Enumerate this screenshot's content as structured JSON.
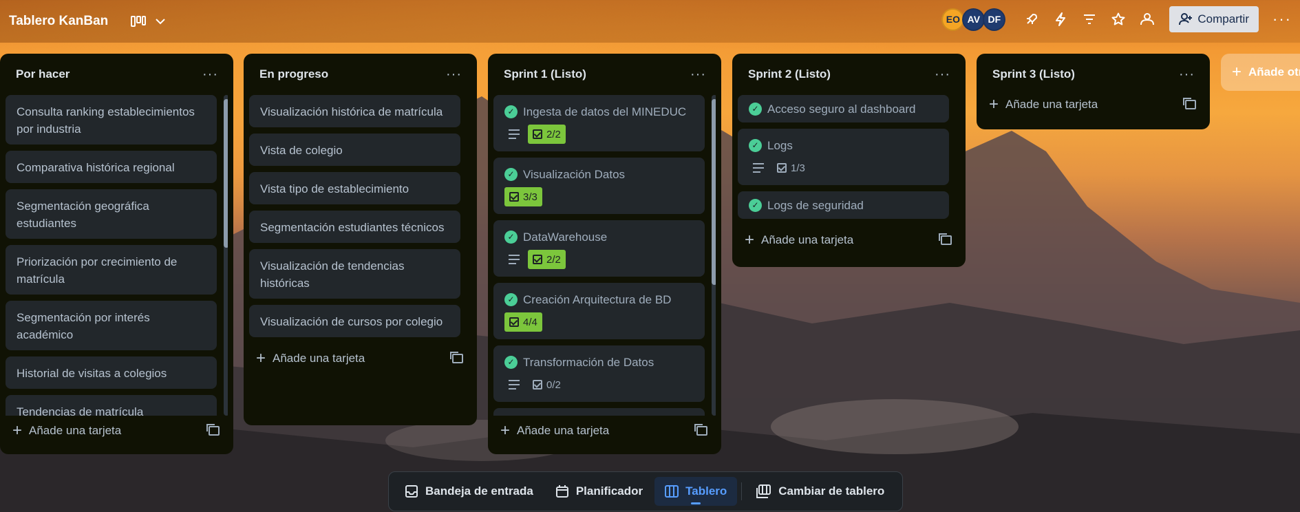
{
  "header": {
    "board_title": "Tablero KanBan",
    "avatars": [
      {
        "initials": "EO",
        "color": "#f5a524",
        "text_color": "#172b4d"
      },
      {
        "initials": "AV",
        "color": "#1f3b6f",
        "text_color": "#ffffff"
      },
      {
        "initials": "DF",
        "color": "#1f3b6f",
        "text_color": "#ffffff"
      }
    ],
    "share_label": "Compartir",
    "icons": [
      "board-view-icon",
      "chevron-down-icon",
      "power-ups-icon",
      "automation-icon",
      "filter-icon",
      "star-icon",
      "visibility-icon",
      "share-person-icon",
      "more-icon"
    ]
  },
  "lists": [
    {
      "title": "Por hacer",
      "add_label": "Añade una tarjeta",
      "cards": [
        {
          "title": "Consulta ranking establecimientos por industria"
        },
        {
          "title": "Comparativa histórica regional"
        },
        {
          "title": "Segmentación geográfica estudiantes"
        },
        {
          "title": "Priorización por crecimiento de matrícula"
        },
        {
          "title": "Segmentación por interés académico"
        },
        {
          "title": "Historial de visitas a colegios"
        },
        {
          "title": "Tendencias de matrícula"
        }
      ]
    },
    {
      "title": "En progreso",
      "add_label": "Añade una tarjeta",
      "cards": [
        {
          "title": "Visualización histórica de matrícula"
        },
        {
          "title": "Vista de colegio"
        },
        {
          "title": "Vista tipo de establecimiento"
        },
        {
          "title": "Segmentación estudiantes técnicos"
        },
        {
          "title": "Visualización de tendencias históricas"
        },
        {
          "title": "Visualización de cursos por colegio"
        }
      ]
    },
    {
      "title": "Sprint 1 (Listo)",
      "add_label": "Añade una tarjeta",
      "cards": [
        {
          "title": "Ingesta de datos del MINEDUC",
          "done": true,
          "desc": true,
          "checklist": "2/2",
          "complete": true
        },
        {
          "title": "Visualización Datos",
          "done": true,
          "desc": false,
          "checklist": "3/3",
          "complete": true
        },
        {
          "title": "DataWarehouse",
          "done": true,
          "desc": true,
          "checklist": "2/2",
          "complete": true
        },
        {
          "title": "Creación Arquitectura de BD",
          "done": true,
          "desc": false,
          "checklist": "4/4",
          "complete": true
        },
        {
          "title": "Transformación de Datos",
          "done": true,
          "desc": true,
          "checklist": "0/2",
          "complete": false
        }
      ]
    },
    {
      "title": "Sprint 2 (Listo)",
      "add_label": "Añade una tarjeta",
      "cards": [
        {
          "title": "Acceso seguro al dashboard",
          "done": true
        },
        {
          "title": "Logs",
          "done": true,
          "desc": true,
          "checklist": "1/3",
          "complete": false
        },
        {
          "title": "Logs de seguridad",
          "done": true
        }
      ]
    },
    {
      "title": "Sprint 3 (Listo)",
      "add_label": "Añade una tarjeta",
      "cards": []
    }
  ],
  "add_list_label": "Añade otra lista",
  "bottom_nav": {
    "items": [
      {
        "label": "Bandeja de entrada",
        "icon": "inbox-icon"
      },
      {
        "label": "Planificador",
        "icon": "calendar-icon"
      },
      {
        "label": "Tablero",
        "icon": "board-icon",
        "active": true
      },
      {
        "label": "Cambiar de tablero",
        "icon": "switch-board-icon"
      }
    ]
  },
  "colors": {
    "list_bg": "#101204",
    "card_bg": "#22272b",
    "done_green": "#4bce97",
    "checklist_complete": "#7cc63c",
    "active_blue": "#579dff"
  }
}
